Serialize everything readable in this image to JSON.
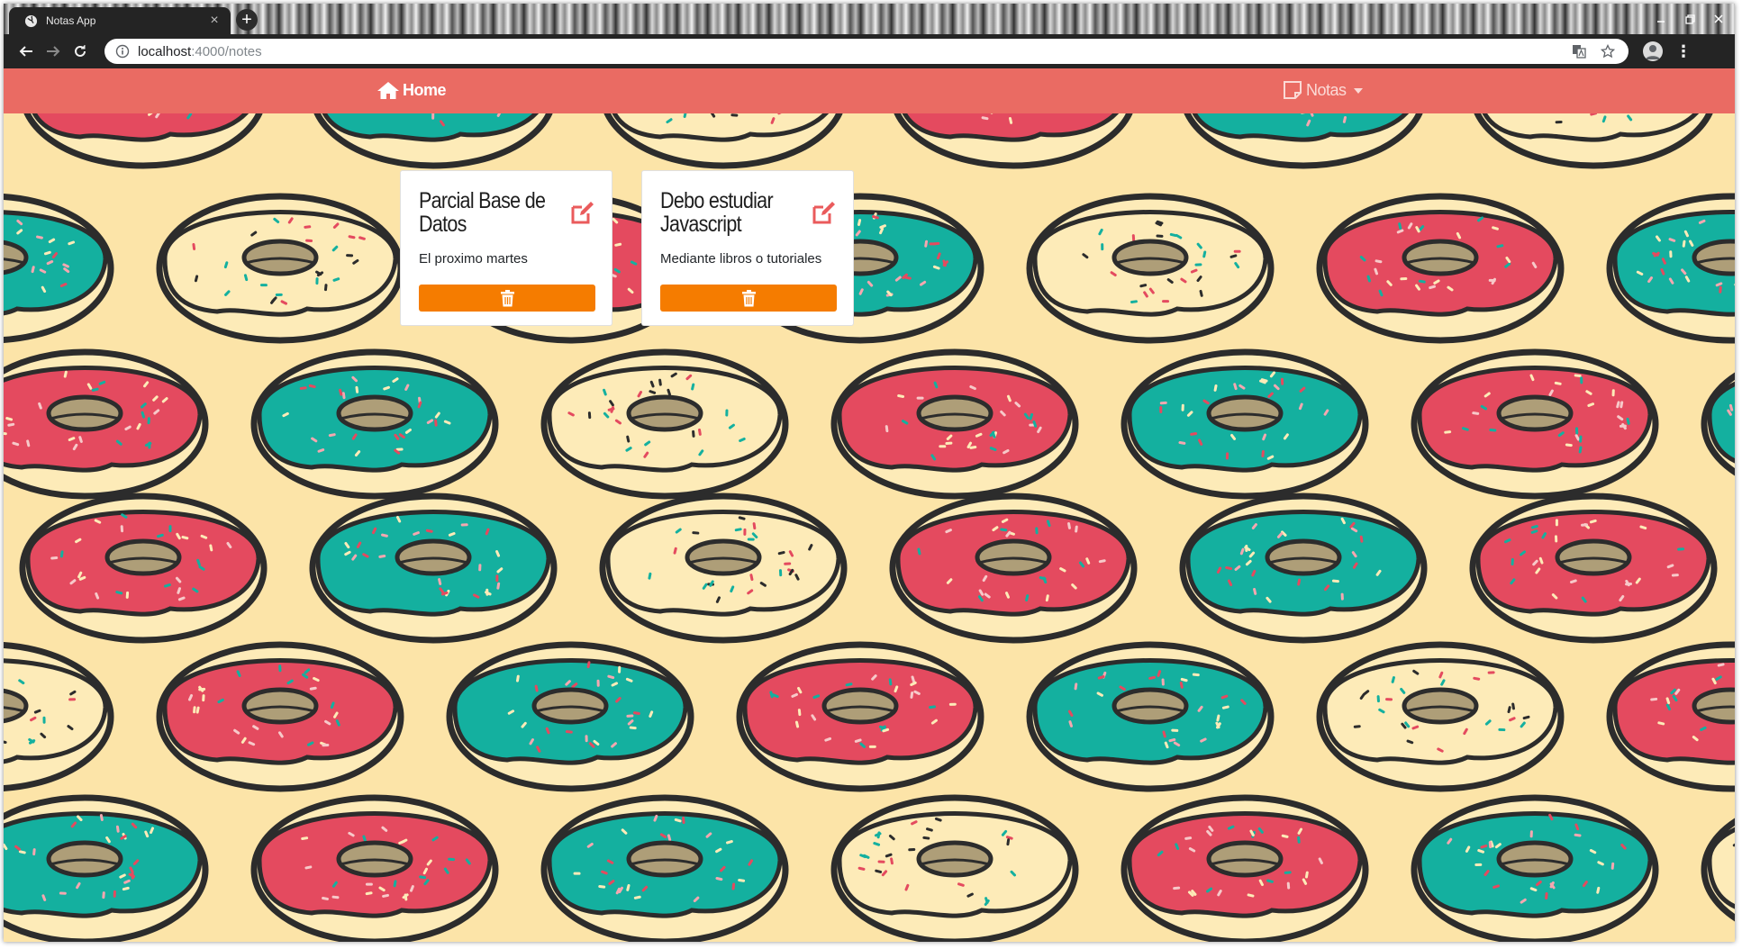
{
  "browser": {
    "tab_title": "Notas App",
    "tab_close": "×",
    "new_tab": "+",
    "url_host": "localhost",
    "url_path": ":4000/notes",
    "menu": "⋮"
  },
  "navbar": {
    "home_label": "Home",
    "notas_label": "Notas",
    "color": "#ea6b63"
  },
  "notes": [
    {
      "title": "Parcial Base de Datos",
      "description": "El proximo martes"
    },
    {
      "title": "Debo estudiar Javascript",
      "description": "Mediante libros o tutoriales"
    }
  ],
  "colors": {
    "page_background": "#fce4a8",
    "delete_button": "#f57c00",
    "edit_icon": "#ea5b5c",
    "donut_pink": "#e44a5f",
    "donut_teal": "#14b09f",
    "donut_cream": "#fdebb8"
  }
}
